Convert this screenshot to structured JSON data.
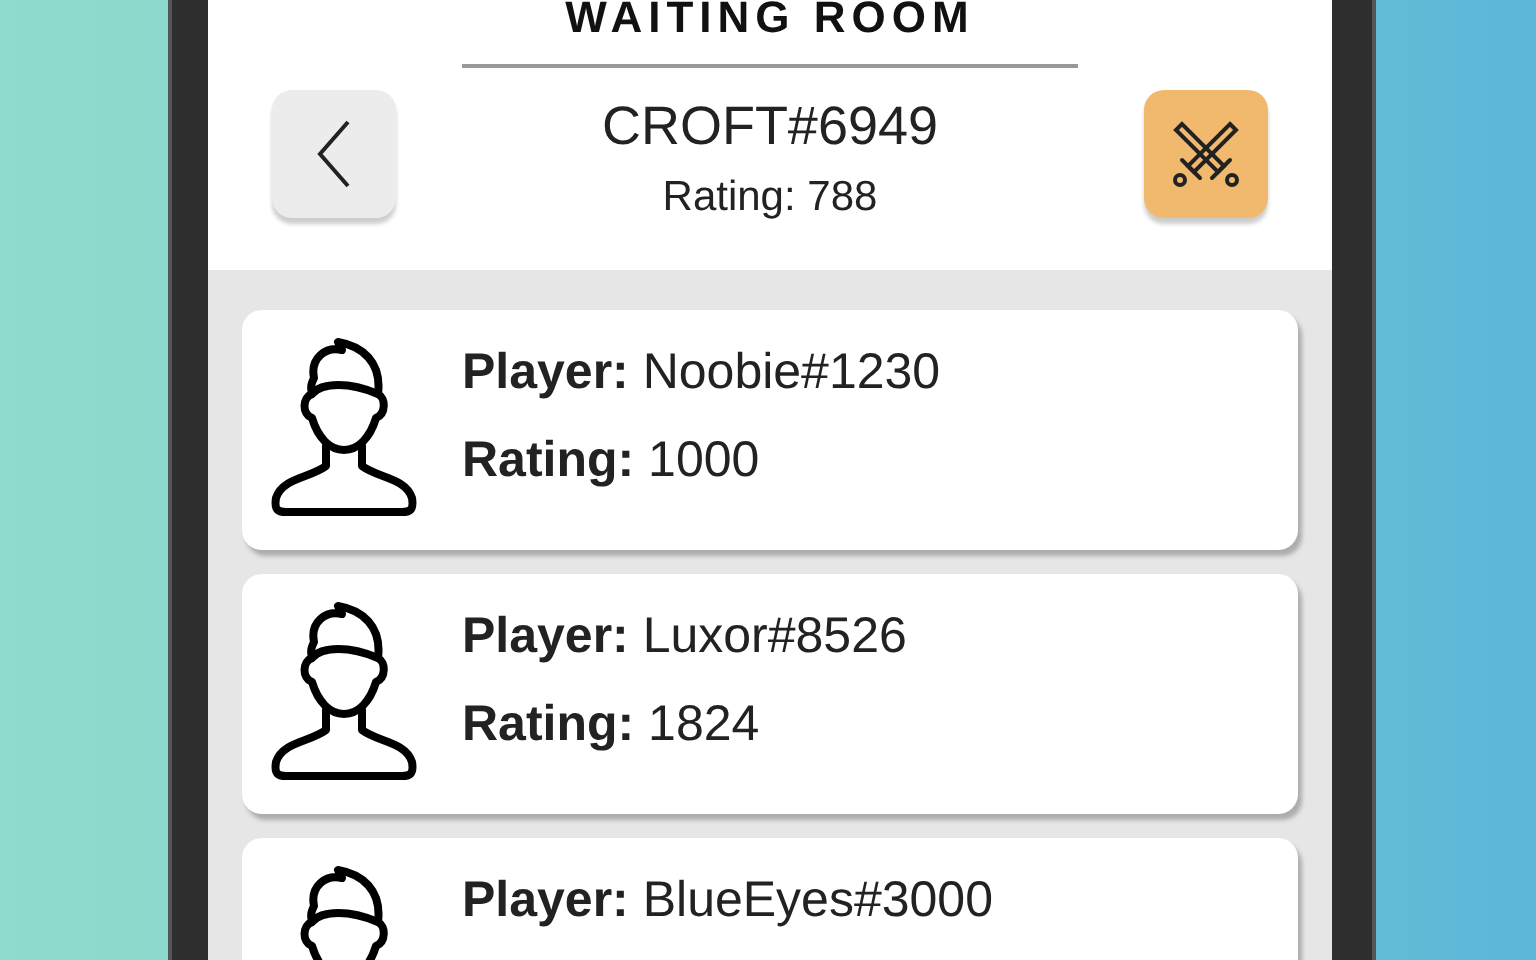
{
  "title": "WAITING ROOM",
  "header": {
    "name": "CROFT#6949",
    "rating": "Rating: 788"
  },
  "players": [
    {
      "player": "**Player:** Noobie#1230",
      "rating": "**Rating:** 1000"
    },
    {
      "player": "**Player:** Luxor#8526",
      "rating": "**Rating:** 1824"
    },
    {
      "player": "**Player:** BlueEyes#3000"
    }
  ]
}
